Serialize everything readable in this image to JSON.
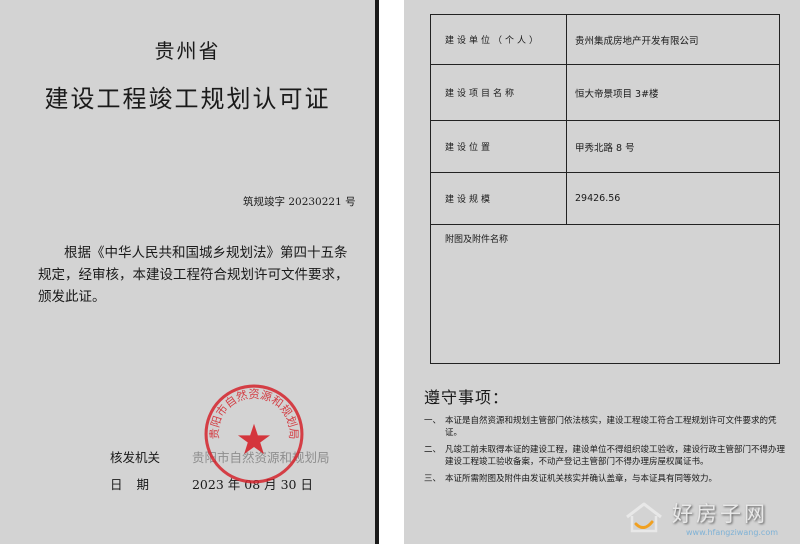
{
  "left": {
    "province": "贵州省",
    "title": "建设工程竣工规划认可证",
    "permit_no": "筑规竣字 20230221 号",
    "body_line1": "根据《中华人民共和国城乡规划法》第四十五条",
    "body_line2": "规定，经审核，本建设工程符合规划许可文件要求，",
    "body_line3": "颁发此证。",
    "issuer_label": "核发机关",
    "issuer_value": "贵阳市自然资源和规划局",
    "date_label": "日期",
    "date_value": "2023 年 08 月 30 日",
    "seal_text": "贵阳市自然资源和规划局"
  },
  "right": {
    "table": [
      {
        "label": "建设单位（个人）",
        "value": "贵州集成房地产开发有限公司"
      },
      {
        "label": "建设项目名称",
        "value": "恒大帝景项目 3#楼"
      },
      {
        "label": "建设位置",
        "value": "甲秀北路 8 号"
      },
      {
        "label": "建设规模",
        "value": "29426.56"
      }
    ],
    "attachments_label": "附图及附件名称",
    "rules_title": "遵守事项：",
    "rules": [
      {
        "num": "一、",
        "text": "本证是自然资源和规划主管部门依法核实，建设工程竣工符合工程规划许可文件要求的凭证。"
      },
      {
        "num": "二、",
        "text": "凡竣工前未取得本证的建设工程，建设单位不得组织竣工验收，建设行政主管部门不得办理建设工程竣工验收备案，不动产登记主管部门不得办理房屋权属证书。"
      },
      {
        "num": "三、",
        "text": "本证所需附图及附件由发证机关核实并确认盖章，与本证具有同等效力。"
      }
    ]
  },
  "watermark": {
    "text": "好房子网",
    "url": "www.hfangziwang.com"
  },
  "colors": {
    "paper": "#d3d3d3",
    "seal": "#d4232b"
  }
}
